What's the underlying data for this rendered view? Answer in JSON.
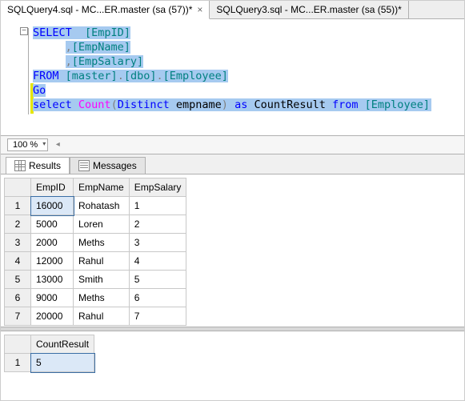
{
  "tabs": {
    "active": {
      "label": "SQLQuery4.sql - MC...ER.master (sa (57))*",
      "close": "×"
    },
    "inactive": {
      "label": "SQLQuery3.sql - MC...ER.master (sa (55))*"
    }
  },
  "sql": {
    "gutter": "−",
    "tokens": {
      "select": "SELECT",
      "empid": "[EmpID]",
      "empname": "[EmpName]",
      "empsalary": "[EmpSalary]",
      "from": "FROM",
      "master": "[master]",
      "dot": ".",
      "dbo": "[dbo]",
      "employee": "[Employee]",
      "go": "Go",
      "select2": "select",
      "count": "Count",
      "lp": "(",
      "distinct": "Distinct",
      "empname2": "empname",
      "rp": ")",
      "as": "as",
      "countresult": "CountResult",
      "from2": "from",
      "employee2": "[Employee]",
      "comma": ","
    }
  },
  "zoom": "100 %",
  "result_tabs": {
    "results": "Results",
    "messages": "Messages"
  },
  "grid1": {
    "cols": [
      "",
      "EmpID",
      "EmpName",
      "EmpSalary"
    ],
    "rows": [
      [
        "1",
        "16000",
        "Rohatash",
        "1"
      ],
      [
        "2",
        "5000",
        "Loren",
        "2"
      ],
      [
        "3",
        "2000",
        "Meths",
        "3"
      ],
      [
        "4",
        "12000",
        "Rahul",
        "4"
      ],
      [
        "5",
        "13000",
        "Smith",
        "5"
      ],
      [
        "6",
        "9000",
        "Meths",
        "6"
      ],
      [
        "7",
        "20000",
        "Rahul",
        "7"
      ]
    ]
  },
  "grid2": {
    "cols": [
      "",
      "CountResult"
    ],
    "rows": [
      [
        "1",
        "5"
      ]
    ]
  },
  "chart_data": {
    "type": "table",
    "tables": [
      {
        "columns": [
          "EmpID",
          "EmpName",
          "EmpSalary"
        ],
        "rows": [
          [
            16000,
            "Rohatash",
            1
          ],
          [
            5000,
            "Loren",
            2
          ],
          [
            2000,
            "Meths",
            3
          ],
          [
            12000,
            "Rahul",
            4
          ],
          [
            13000,
            "Smith",
            5
          ],
          [
            9000,
            "Meths",
            6
          ],
          [
            20000,
            "Rahul",
            7
          ]
        ]
      },
      {
        "columns": [
          "CountResult"
        ],
        "rows": [
          [
            5
          ]
        ]
      }
    ]
  }
}
